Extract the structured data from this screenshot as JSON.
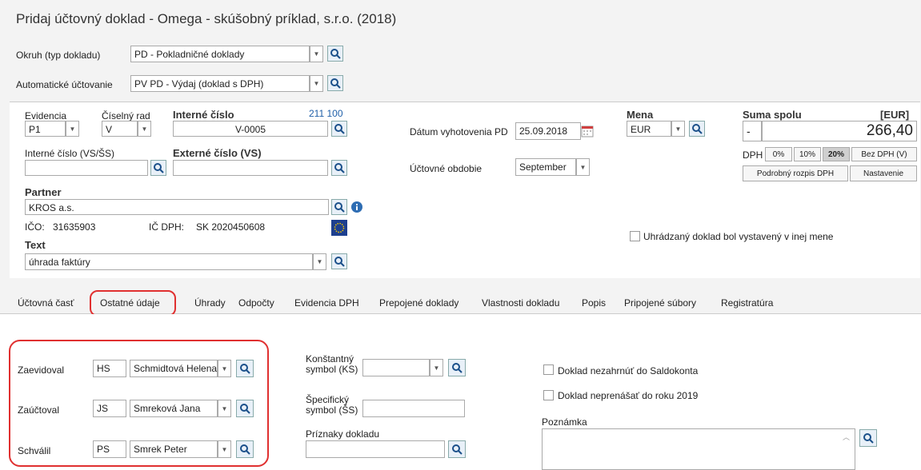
{
  "window": {
    "title": "Pridaj účtovný doklad - Omega - skúšobný príklad, s.r.o. (2018)"
  },
  "header": {
    "okruh_label": "Okruh (typ dokladu)",
    "okruh_value": "PD - Pokladničné doklady",
    "auto_label": "Automatické účtovanie",
    "auto_value": "PV PD - Výdaj (doklad s DPH)"
  },
  "doc": {
    "evidencia_label": "Evidencia",
    "evidencia_value": "P1",
    "rad_label": "Číselný rad",
    "rad_value": "V",
    "interne_label": "Interné číslo",
    "interne_count": "211 100",
    "interne_value": "V-0005",
    "vs_label": "Interné číslo (VS/ŠS)",
    "vs_value": "",
    "externe_label": "Externé číslo (VS)",
    "externe_value": "",
    "datum_label": "Dátum vyhotovenia PD",
    "datum_value": "25.09.2018",
    "obdobie_label": "Účtovné obdobie",
    "obdobie_value": "September",
    "mena_label": "Mena",
    "mena_value": "EUR",
    "suma_label": "Suma spolu",
    "suma_currency": "[EUR]",
    "suma_sign": "-",
    "suma_value": "266,40",
    "dph_label": "DPH",
    "dph_options": [
      "0%",
      "10%",
      "20%"
    ],
    "bez_dph": "Bez DPH (V)",
    "rozpis_dph": "Podrobný rozpis DPH",
    "nastavenie": "Nastavenie",
    "partner_label": "Partner",
    "partner_value": "KROS a.s.",
    "ico_label": "IČO:",
    "ico_value": "31635903",
    "icdph_label": "IČ DPH:",
    "icdph_value": "SK 2020450608",
    "text_label": "Text",
    "text_value": "úhrada faktúry",
    "foreign_currency_label": "Uhrádzaný doklad bol vystavený v inej mene"
  },
  "tabs": [
    {
      "label": "Účtovná časť"
    },
    {
      "label": "Ostatné údaje"
    },
    {
      "label": "Úhrady"
    },
    {
      "label": "Odpočty"
    },
    {
      "label": "Evidencia DPH"
    },
    {
      "label": "Prepojené doklady"
    },
    {
      "label": "Vlastnosti dokladu"
    },
    {
      "label": "Popis"
    },
    {
      "label": "Pripojené súbory"
    },
    {
      "label": "Registratúra"
    }
  ],
  "other": {
    "zaevidoval_label": "Zaevidoval",
    "zaevidoval_code": "HS",
    "zaevidoval_name": "Schmidtová Helena",
    "zauctoval_label": "Zaúčtoval",
    "zauctoval_code": "JS",
    "zauctoval_name": "Smreková Jana",
    "schvalil_label": "Schválil",
    "schvalil_code": "PS",
    "schvalil_name": "Smrek Peter",
    "ks_label_1": "Konštantný",
    "ks_label_2": "symbol (KS)",
    "ss_label_1": "Špecifický",
    "ss_label_2": "symbol (ŠS)",
    "priznaky_label": "Príznaky dokladu",
    "saldokonto_label": "Doklad nezahrnúť do Saldokonta",
    "neprenasat_label": "Doklad neprenášať do roku 2019",
    "poznamka_label": "Poznámka"
  },
  "colors": {
    "accent_red": "#e03030",
    "link_blue": "#1f5fa8"
  }
}
